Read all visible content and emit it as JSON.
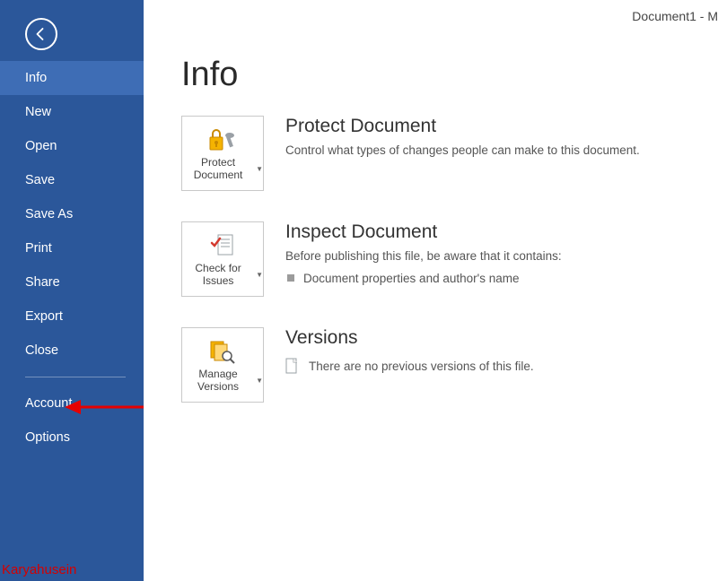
{
  "doc_title": "Document1 - M",
  "sidebar": {
    "items": [
      {
        "label": "Info",
        "selected": true
      },
      {
        "label": "New"
      },
      {
        "label": "Open"
      },
      {
        "label": "Save"
      },
      {
        "label": "Save As"
      },
      {
        "label": "Print"
      },
      {
        "label": "Share"
      },
      {
        "label": "Export"
      },
      {
        "label": "Close"
      }
    ],
    "account": "Account",
    "options": "Options"
  },
  "page_title": "Info",
  "protect": {
    "tile_label": "Protect Document",
    "heading": "Protect Document",
    "desc": "Control what types of changes people can make to this document."
  },
  "inspect": {
    "tile_label": "Check for Issues",
    "heading": "Inspect Document",
    "desc": "Before publishing this file, be aware that it contains:",
    "issue": "Document properties and author's name"
  },
  "versions": {
    "tile_label": "Manage Versions",
    "heading": "Versions",
    "desc": "There are no previous versions of this file."
  },
  "watermark": "Karyahusein"
}
